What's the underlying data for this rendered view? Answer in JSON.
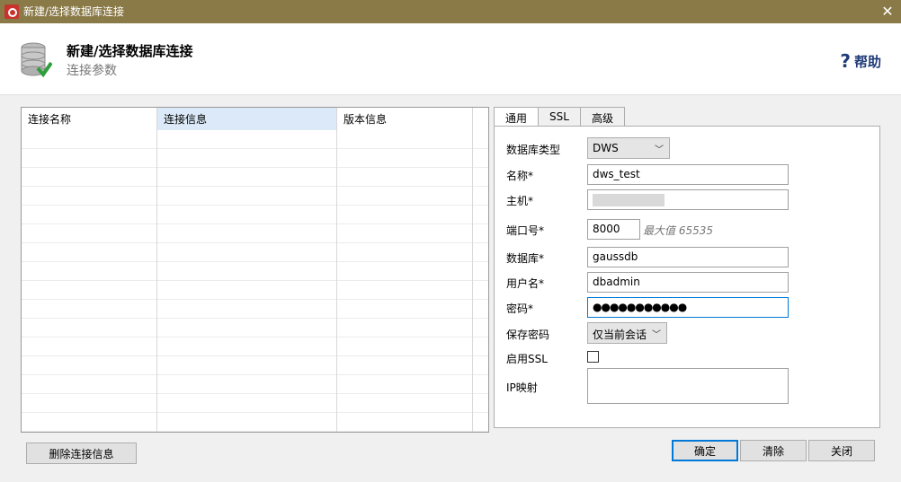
{
  "window": {
    "title": "新建/选择数据库连接",
    "close_glyph": "✕"
  },
  "header": {
    "title": "新建/选择数据库连接",
    "subtitle": "连接参数",
    "help_label": "帮助",
    "help_glyph": "?"
  },
  "connections_table": {
    "columns": [
      "连接名称",
      "连接信息",
      "版本信息"
    ],
    "rows": []
  },
  "buttons": {
    "delete_label": "删除连接信息",
    "ok_label": "确定",
    "clear_label": "清除",
    "close_label": "关闭"
  },
  "tabs": [
    "通用",
    "SSL",
    "高级"
  ],
  "form": {
    "db_type_label": "数据库类型",
    "db_type_value": "DWS",
    "name_label": "名称*",
    "name_value": "dws_test",
    "host_label": "主机*",
    "host_value": "",
    "port_label": "端口号*",
    "port_value": "8000",
    "port_hint": "最大值 65535",
    "database_label": "数据库*",
    "database_value": "gaussdb",
    "username_label": "用户名*",
    "username_value": "dbadmin",
    "password_label": "密码*",
    "password_value": "●●●●●●●●●●●",
    "save_password_label": "保存密码",
    "save_password_value": "仅当前会话",
    "enable_ssl_label": "启用SSL",
    "enable_ssl_checked": false,
    "ip_mapping_label": "IP映射",
    "ip_mapping_value": ""
  },
  "colors": {
    "titlebar": "#8a7a48",
    "accent": "#0078d7",
    "help": "#1f3b78"
  }
}
